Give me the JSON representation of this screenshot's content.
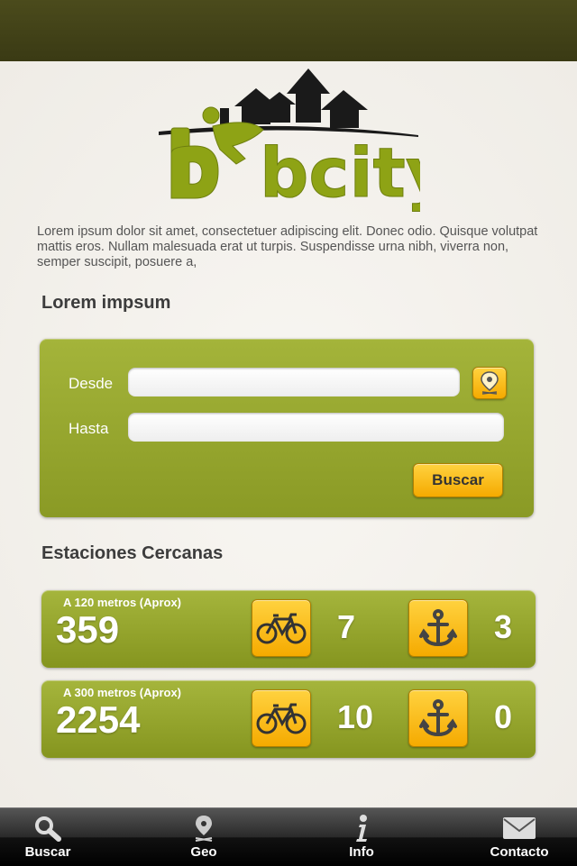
{
  "logo": {
    "text": "bcity"
  },
  "intro": "Lorem ipsum dolor sit amet, consectetuer adipiscing elit. Donec odio. Quisque volutpat mattis eros. Nullam malesuada erat ut turpis. Suspendisse urna nibh, viverra non, semper suscipit, posuere a,",
  "search": {
    "heading": "Lorem impsum",
    "from_label": "Desde",
    "from_value": "",
    "to_label": "Hasta",
    "to_value": "",
    "geo_icon": "map-pin-icon",
    "button_label": "Buscar"
  },
  "stations": {
    "heading": "Estaciones Cercanas",
    "items": [
      {
        "distance": "A 120 metros (Aprox)",
        "code": "359",
        "bikes": "7",
        "docks": "3"
      },
      {
        "distance": "A 300 metros (Aprox)",
        "code": "2254",
        "bikes": "10",
        "docks": "0"
      }
    ],
    "bike_icon": "bicycle-icon",
    "dock_icon": "anchor-icon"
  },
  "tabbar": {
    "items": [
      {
        "label": "Buscar",
        "icon": "search-icon"
      },
      {
        "label": "Geo",
        "icon": "map-pin-icon"
      },
      {
        "label": "Info",
        "icon": "info-icon"
      },
      {
        "label": "Contacto",
        "icon": "mail-icon"
      }
    ]
  },
  "colors": {
    "accent_green": "#95a52c",
    "button_yellow": "#f9bf1a",
    "logo_green": "#8ea315"
  }
}
